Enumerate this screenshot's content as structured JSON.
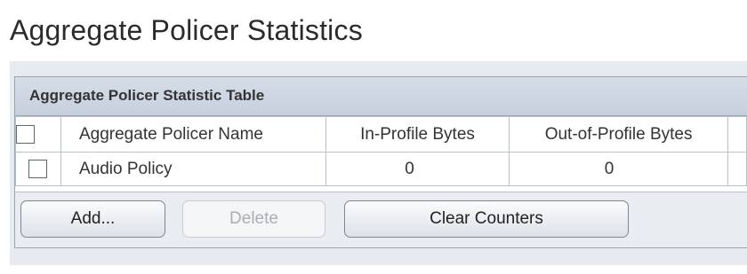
{
  "page": {
    "title": "Aggregate Policer Statistics"
  },
  "panel": {
    "title": "Aggregate Policer Statistic Table"
  },
  "table": {
    "columns": [
      "Aggregate Policer Name",
      "In-Profile Bytes",
      "Out-of-Profile Bytes"
    ],
    "rows": [
      {
        "name": "Audio Policy",
        "in_profile_bytes": "0",
        "out_of_profile_bytes": "0",
        "checked": false
      }
    ]
  },
  "buttons": {
    "add_label": "Add...",
    "delete_label": "Delete",
    "clear_counters_label": "Clear Counters"
  },
  "colors": {
    "header_bg": "#cdd6e1",
    "content_bg": "#e7ebf0",
    "border": "#9aa5b1"
  }
}
